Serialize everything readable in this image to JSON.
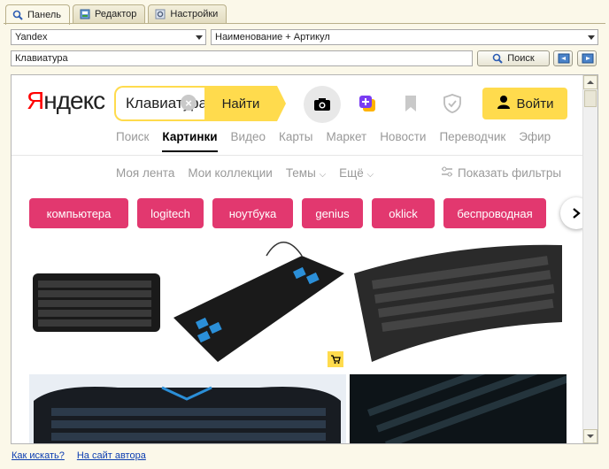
{
  "tabs": [
    {
      "label": "Панель",
      "icon": "search-icon",
      "active": true
    },
    {
      "label": "Редактор",
      "icon": "editor-icon",
      "active": false
    },
    {
      "label": "Настройки",
      "icon": "settings-icon",
      "active": false
    }
  ],
  "engine_select": {
    "value": "Yandex"
  },
  "mode_select": {
    "value": "Наименование + Артикул"
  },
  "query_input": {
    "value": "Клавиатура"
  },
  "search_button": {
    "label": "Поиск"
  },
  "browser": {
    "logo": {
      "first": "Я",
      "rest": "ндекс"
    },
    "search_value": "Клавиатура",
    "find_label": "Найти",
    "login_label": "Войти",
    "nav": [
      "Поиск",
      "Картинки",
      "Видео",
      "Карты",
      "Маркет",
      "Новости",
      "Переводчик",
      "Эфир"
    ],
    "nav_active": "Картинки",
    "subnav": [
      "Моя лента",
      "Мои коллекции",
      "Темы",
      "Ещё"
    ],
    "filters_label": "Показать фильтры",
    "chips": [
      "компьютера",
      "logitech",
      "ноутбука",
      "genius",
      "oklick",
      "беспроводная"
    ],
    "brand_color": "#ffdb4d",
    "chip_color": "#e2386f"
  },
  "footer": {
    "how_to": "Как искать?",
    "author_site": "На сайт автора"
  }
}
